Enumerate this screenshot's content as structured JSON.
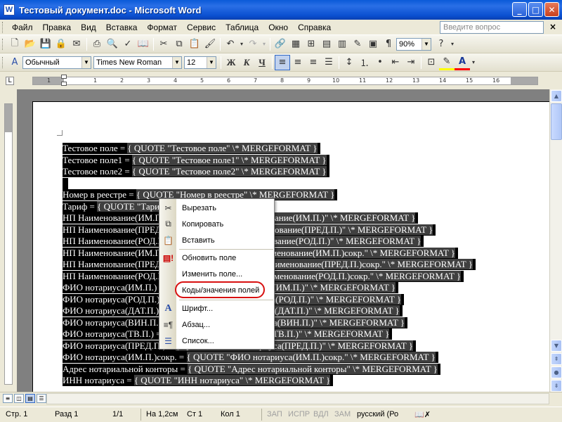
{
  "window": {
    "title": "Тестовый документ.doc - Microsoft Word",
    "app_icon": "W",
    "controls": [
      "minimize-icon",
      "maximize-icon",
      "close-icon"
    ]
  },
  "menubar": {
    "items": [
      "Файл",
      "Правка",
      "Вид",
      "Вставка",
      "Формат",
      "Сервис",
      "Таблица",
      "Окно",
      "Справка"
    ],
    "help_placeholder": "Введите вопрос",
    "close_glyph": "×"
  },
  "toolbar_standard": {
    "zoom": "90%",
    "icons": [
      "new-doc-icon",
      "open-icon",
      "save-icon",
      "permission-icon",
      "email-icon",
      "print-icon",
      "print-preview-icon",
      "spelling-icon",
      "research-icon",
      "cut-icon",
      "copy-icon",
      "paste-icon",
      "format-painter-icon",
      "undo-icon",
      "redo-icon",
      "hyperlink-icon",
      "tables-borders-icon",
      "insert-table-icon",
      "insert-excel-icon",
      "columns-icon",
      "drawing-icon",
      "document-map-icon",
      "show-hide-icon",
      "help-icon",
      "read-icon"
    ]
  },
  "toolbar_formatting": {
    "style": "Обычный",
    "font": "Times New Roman",
    "size": "12",
    "bold": "Ж",
    "italic": "К",
    "underline": "Ч",
    "highlight_color": "#ffff00",
    "font_color": "#ff0000"
  },
  "ruler": {
    "corner": "L",
    "marks": [
      "1",
      "1",
      "2",
      "3",
      "4",
      "5",
      "6",
      "7",
      "8",
      "9",
      "10",
      "11",
      "12",
      "13",
      "14",
      "15",
      "16"
    ]
  },
  "document": {
    "lines": [
      {
        "text": "Тестовое поле  = ",
        "field": "{ QUOTE \"Тестовое поле\"  \\* MERGEFORMAT }"
      },
      {
        "text": "Тестовое поле1  = ",
        "field": "{ QUOTE \"Тестовое поле1\"  \\* MERGEFORMAT }"
      },
      {
        "text": "Тестовое поле2  = ",
        "field": "{ QUOTE \"Тестовое поле2\"  \\* MERGEFORMAT }"
      },
      {
        "text": "",
        "field": ""
      },
      {
        "text": "Номер в реестре = ",
        "field": "{ QUOTE \"Номер в реестре\"  \\* MERGEFORMAT }"
      },
      {
        "text": "Тариф = ",
        "field": "{ QUOTE \"Тариф\"  \\* MERGEFORMAT }"
      },
      {
        "text": "НП Наименование(ИМ.П.) = ",
        "field": "{ QUOTE \"НП Наименование(ИМ.П.)\"  \\* MERGEFORMAT }"
      },
      {
        "text": "НП Наименование(ПРЕД.П.) = ",
        "field": "{ QUOTE \"НП Наименование(ПРЕД.П.)\"  \\* MERGEFORMAT }"
      },
      {
        "text": "НП Наименование(РОД.П.) = ",
        "field": "{ QUOTE \"НП Наименование(РОД.П.)\"  \\* MERGEFORMAT }"
      },
      {
        "text": "НП Наименование(ИМ.П.)сокр. = ",
        "field": "{ QUOTE \"НП Наименование(ИМ.П.)сокр.\"  \\* MERGEFORMAT }"
      },
      {
        "text": "НП Наименование(ПРЕД.П.)сокр. = ",
        "field": "{ QUOTE \"НП Наименование(ПРЕД.П.)сокр.\"  \\* MERGEFORMAT }"
      },
      {
        "text": "НП Наименование(РОД.П.)сокр. = ",
        "field": "{ QUOTE \"НП Наименование(РОД.П.)сокр.\"  \\* MERGEFORMAT }"
      },
      {
        "text": "ФИО нотариуса(ИМ.П.) = ",
        "field": "{ QUOTE \"ФИО нотариуса(ИМ.П.)\"  \\* MERGEFORMAT }"
      },
      {
        "text": "ФИО нотариуса(РОД.П.) = ",
        "field": "{ QUOTE \"ФИО нотариуса(РОД.П.)\"  \\* MERGEFORMAT }"
      },
      {
        "text": "ФИО нотариуса(ДАТ.П.) = ",
        "field": "{ QUOTE \"ФИО нотариуса(ДАТ.П.)\"  \\* MERGEFORMAT }"
      },
      {
        "text": "ФИО нотариуса(ВИН.П.) = ",
        "field": "{ QUOTE \"ФИО нотариуса(ВИН.П.)\"  \\* MERGEFORMAT }"
      },
      {
        "text": "ФИО нотариуса(ТВ.П.) = ",
        "field": "{ QUOTE \"ФИО нотариуса(ТВ.П.)\"  \\* MERGEFORMAT }"
      },
      {
        "text": "ФИО нотариуса(ПРЕД.П.) = ",
        "field": "{ QUOTE \"ФИО нотариуса(ПРЕД.П.)\"  \\* MERGEFORMAT }"
      },
      {
        "text": "ФИО нотариуса(ИМ.П.)сокр. = ",
        "field": "{ QUOTE \"ФИО нотариуса(ИМ.П.)сокр.\"  \\* MERGEFORMAT }"
      },
      {
        "text": "Адрес нотариальной конторы  = ",
        "field": "{ QUOTE \"Адрес нотариальной конторы\"  \\* MERGEFORMAT }"
      },
      {
        "text": "ИНН нотариуса = ",
        "field": "{ QUOTE \"ИНН нотариуса\"  \\* MERGEFORMAT }"
      }
    ]
  },
  "context_menu": {
    "items": [
      {
        "label": "Вырезать",
        "icon": "cut-icon"
      },
      {
        "label": "Копировать",
        "icon": "copy-icon"
      },
      {
        "label": "Вставить",
        "icon": "paste-icon"
      },
      {
        "label": "Обновить поле",
        "icon": "update-field-icon"
      },
      {
        "label": "Изменить поле...",
        "icon": ""
      },
      {
        "label": "Коды/значения полей",
        "icon": "",
        "highlighted": true
      },
      {
        "label": "Шрифт...",
        "icon": "font-icon"
      },
      {
        "label": "Абзац...",
        "icon": "paragraph-icon"
      },
      {
        "label": "Список...",
        "icon": "list-icon"
      }
    ],
    "highlight_color": "#d81010"
  },
  "statusbar": {
    "page": "Стр. 1",
    "section": "Разд 1",
    "pages": "1/1",
    "position": "На 1,2см",
    "line": "Ст 1",
    "column": "Кол 1",
    "rec": "ЗАП",
    "trk": "ИСПР",
    "ext": "ВДЛ",
    "ovr": "ЗАМ",
    "language": "русский (Ро"
  }
}
